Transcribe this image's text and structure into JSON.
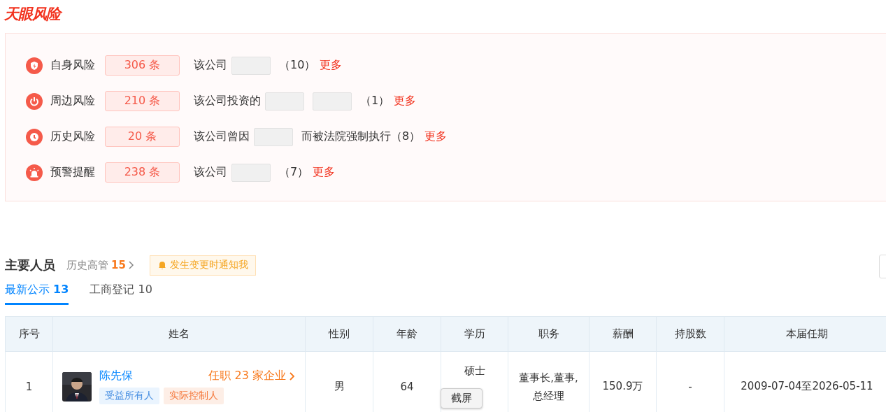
{
  "logo": "天眼风险",
  "risks": [
    {
      "kind": "self",
      "label": "自身风险",
      "count": "306 条",
      "parts": [
        {
          "kind": "text",
          "text": "该公司"
        },
        {
          "kind": "redacted"
        },
        {
          "kind": "text",
          "text": "（10）"
        }
      ],
      "more": "更多"
    },
    {
      "kind": "around",
      "label": "周边风险",
      "count": "210 条",
      "parts": [
        {
          "kind": "text",
          "text": "该公司投资的"
        },
        {
          "kind": "redacted"
        },
        {
          "kind": "redacted"
        },
        {
          "kind": "text",
          "text": "（1）"
        }
      ],
      "more": "更多"
    },
    {
      "kind": "history",
      "label": "历史风险",
      "count": "20 条",
      "parts": [
        {
          "kind": "text",
          "text": "该公司曾因"
        },
        {
          "kind": "redacted"
        },
        {
          "kind": "text",
          "text": "而被法院强制执行（8）"
        }
      ],
      "more": "更多"
    },
    {
      "kind": "alert",
      "label": "预警提醒",
      "count": "238 条",
      "parts": [
        {
          "kind": "text",
          "text": "该公司"
        },
        {
          "kind": "redacted"
        },
        {
          "kind": "text",
          "text": "（7）"
        }
      ],
      "more": "更多"
    }
  ],
  "people": {
    "title": "主要人员",
    "history": {
      "label": "历史高管",
      "count": "15"
    },
    "notify": "发生变更时通知我",
    "tabs": [
      {
        "label": "最新公示",
        "count": "13",
        "selected": true
      },
      {
        "label": "工商登记",
        "count": "10",
        "selected": false
      }
    ],
    "columns": [
      "序号",
      "姓名",
      "性别",
      "年龄",
      "学历",
      "职务",
      "薪酬",
      "持股数",
      "本届任期"
    ],
    "rows": [
      {
        "index": "1",
        "name": "陈先保",
        "positions": "任职 23 家企业",
        "tags": [
          {
            "label": "受益所有人",
            "kind": "beneficiary"
          },
          {
            "label": "实际控制人",
            "kind": "controller"
          }
        ],
        "gender": "男",
        "age": "64",
        "education": "硕士",
        "title": "董事长,董事,总经理",
        "salary": "150.9万",
        "shares": "-",
        "term": "2009-07-04至2026-05-11"
      }
    ]
  },
  "tooltip": "截屏"
}
